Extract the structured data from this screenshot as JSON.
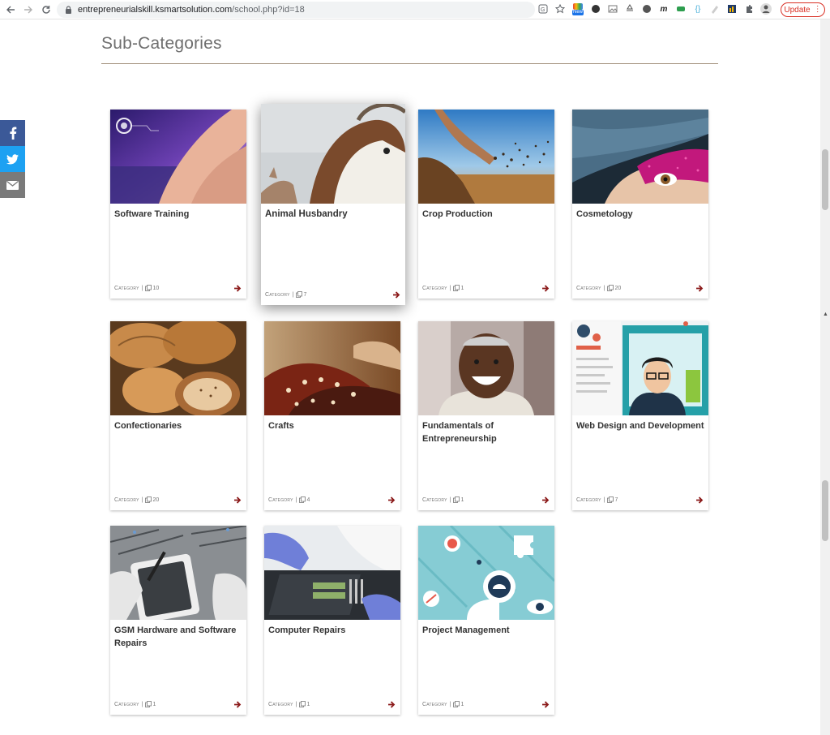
{
  "browser": {
    "url_host": "entrepreneurialskill.ksmartsolution.com",
    "url_path": "/school.php?id=18",
    "ext_new_badge": "New",
    "update_label": "Update"
  },
  "page": {
    "heading": "Sub-Categories"
  },
  "cards": [
    {
      "title": "Software Training",
      "category": "Category",
      "count": "10"
    },
    {
      "title": "Animal Husbandry",
      "category": "Category",
      "count": "7"
    },
    {
      "title": "Crop Production",
      "category": "Category",
      "count": "1"
    },
    {
      "title": "Cosmetology",
      "category": "Category",
      "count": "20"
    },
    {
      "title": "Confectionaries",
      "category": "Category",
      "count": "20"
    },
    {
      "title": "Crafts",
      "category": "Category",
      "count": "4"
    },
    {
      "title": "Fundamentals of Entrepreneurship",
      "category": "Category",
      "count": "1"
    },
    {
      "title": "Web Design and Development",
      "category": "Category",
      "count": "7"
    },
    {
      "title": "GSM Hardware and Software Repairs",
      "category": "Category",
      "count": "1"
    },
    {
      "title": "Computer Repairs",
      "category": "Category",
      "count": "1"
    },
    {
      "title": "Project Management",
      "category": "Category",
      "count": "1"
    }
  ],
  "colors": {
    "arrow": "#8b1a1a",
    "facebook": "#3b5998",
    "twitter": "#1da1f2",
    "email": "#7a7a7a"
  }
}
